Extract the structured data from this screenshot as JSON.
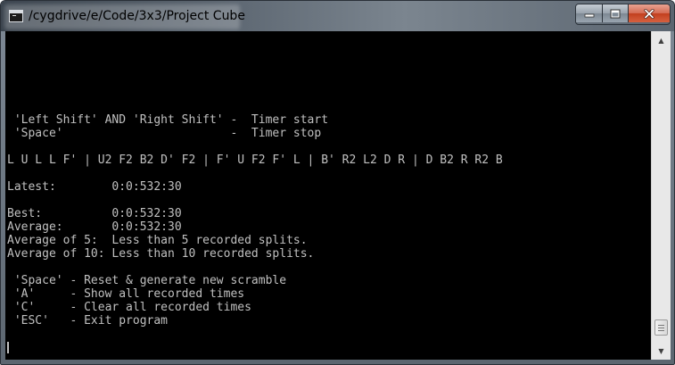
{
  "window": {
    "title": "/cygdrive/e/Code/3x3/Project Cube"
  },
  "console": {
    "lines": [
      " 'Left Shift' AND 'Right Shift' -  Timer start",
      " 'Space'                        -  Timer stop",
      "",
      "L U L L F' | U2 F2 B2 D' F2 | F' U F2 F' L | B' R2 L2 D R | D B2 R R2 B",
      "",
      "Latest:        0:0:532:30",
      "",
      "Best:          0:0:532:30",
      "Average:       0:0:532:30",
      "Average of 5:  Less than 5 recorded splits.",
      "Average of 10: Less than 10 recorded splits.",
      "",
      " 'Space' - Reset & generate new scramble",
      " 'A'     - Show all recorded times",
      " 'C'     - Clear all recorded times",
      " 'ESC'   - Exit program"
    ]
  },
  "icons": {
    "app": "console-icon",
    "minimize": "minimize-icon",
    "maximize": "maximize-icon",
    "close": "close-icon",
    "scroll_up": "up-arrow-icon",
    "scroll_down": "down-arrow-icon"
  },
  "scrollbar": {
    "up_glyph": "▲",
    "down_glyph": "▼"
  },
  "colors": {
    "console_background": "#000000",
    "console_text": "#c0c0c0",
    "close_button": "#c7432a"
  }
}
